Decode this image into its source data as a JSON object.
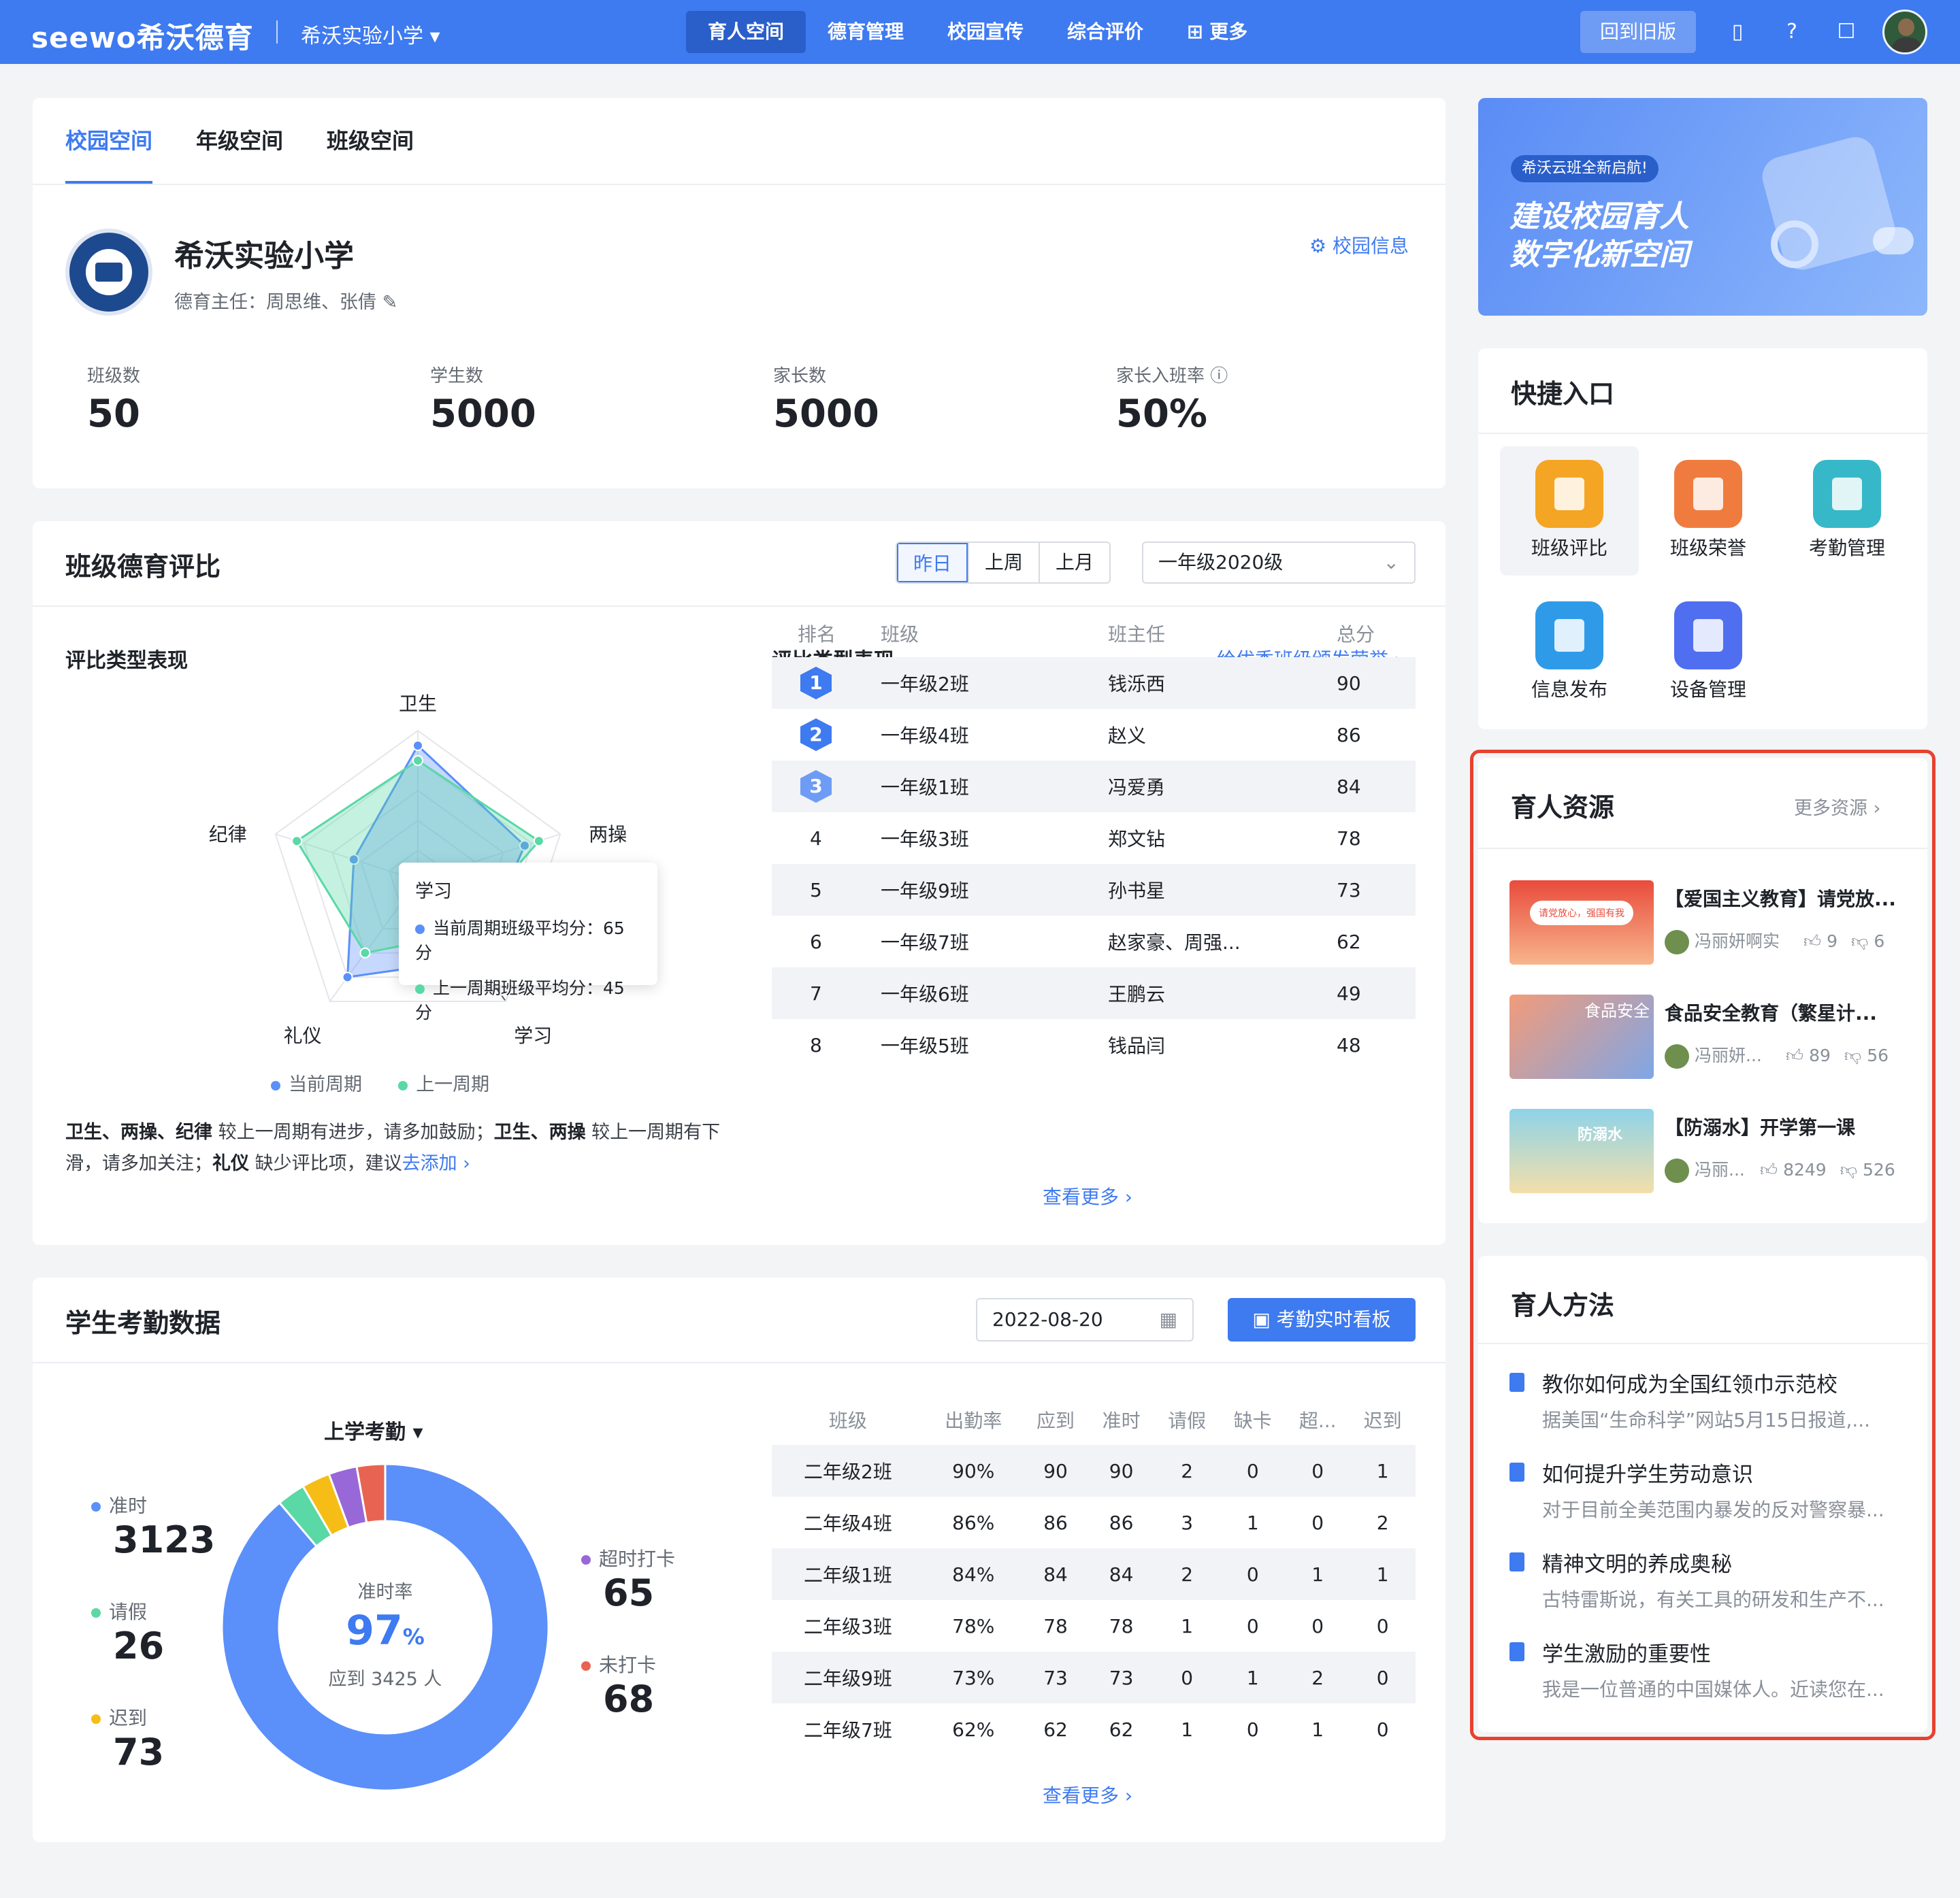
{
  "topbar": {
    "logo": "seewo希沃德育",
    "school": "希沃实验小学 ▾",
    "nav": [
      "育人空间",
      "德育管理",
      "校园宣传",
      "综合评价",
      "⊞ 更多"
    ],
    "old_version": "回到旧版"
  },
  "school_card": {
    "tabs": [
      "校园空间",
      "年级空间",
      "班级空间"
    ],
    "name": "希沃实验小学",
    "director": "德育主任：周思维、张倩 ✎",
    "info_link": "⚙ 校园信息",
    "stats": [
      {
        "label": "班级数",
        "value": "50"
      },
      {
        "label": "学生数",
        "value": "5000"
      },
      {
        "label": "家长数",
        "value": "5000"
      },
      {
        "label": "家长入班率 ⓘ",
        "value": "50%"
      }
    ]
  },
  "eval_card": {
    "title": "班级德育评比",
    "periods": [
      "昨日",
      "上周",
      "上月"
    ],
    "grade_select": "一年级2020级",
    "left_title": "评比类型表现",
    "right_title": "评比类型表现",
    "award_link": "给优秀班级颁发荣誉 ›",
    "legend": [
      "当前周期",
      "上一周期"
    ],
    "tooltip": {
      "title": "学习",
      "current": "当前周期班级平均分：65分",
      "previous": "上一周期班级平均分：45分"
    },
    "summary": [
      {
        "b": "卫生、两操、纪律"
      },
      {
        "t": " 较上一周期有进步，请多加鼓励；"
      },
      {
        "b": "卫生、两操"
      },
      {
        "t": " 较上一周期有下滑，请多加关注；"
      },
      {
        "b": "礼仪"
      },
      {
        "t": " 缺少评比项，建议去添加 "
      },
      {
        "l": "去添加 ›"
      }
    ],
    "rank_headers": [
      "排名",
      "班级",
      "班主任",
      "总分"
    ],
    "rank_rows": [
      [
        "1",
        "一年级2班",
        "钱泺西",
        "90"
      ],
      [
        "2",
        "一年级4班",
        "赵义",
        "86"
      ],
      [
        "3",
        "一年级1班",
        "冯爱勇",
        "84"
      ],
      [
        "4",
        "一年级3班",
        "郑文钻",
        "78"
      ],
      [
        "5",
        "一年级9班",
        "孙书星",
        "73"
      ],
      [
        "6",
        "一年级7班",
        "赵家豪、周强...",
        "62"
      ],
      [
        "7",
        "一年级6班",
        "王鹏云",
        "49"
      ],
      [
        "8",
        "一年级5班",
        "钱品闫",
        "48"
      ]
    ],
    "more": "查看更多 ›"
  },
  "chart_data": [
    {
      "type": "radar",
      "axes": [
        "卫生",
        "两操",
        "学习",
        "礼仪",
        "纪律"
      ],
      "series": [
        {
          "name": "当前周期",
          "values": [
            90,
            75,
            65,
            80,
            45
          ]
        },
        {
          "name": "上一周期",
          "values": [
            80,
            85,
            45,
            60,
            85
          ]
        }
      ],
      "range": [
        0,
        100
      ],
      "color_current": "#5b8ff9",
      "color_previous": "#5ad8a6"
    },
    {
      "type": "pie",
      "center_label": "准时率",
      "center_value": "97",
      "center_unit": "%",
      "center_sub": "应到 3425 人",
      "slices": [
        {
          "name": "准时",
          "value": 3123,
          "color": "#5b8ff9"
        },
        {
          "name": "请假",
          "value": 26,
          "color": "#5ad8a6"
        },
        {
          "name": "迟到",
          "value": 73,
          "color": "#f6bd16"
        },
        {
          "name": "超时打卡",
          "value": 65,
          "color": "#9867d8"
        },
        {
          "name": "未打卡",
          "value": 68,
          "color": "#e86452"
        }
      ]
    }
  ],
  "attendance_card": {
    "title": "学生考勤数据",
    "date": "2022-08-20",
    "board_btn": "考勤实时看板",
    "mode": "上学考勤 ▾",
    "kpis": [
      {
        "label": "准时",
        "value": "3123"
      },
      {
        "label": "请假",
        "value": "26"
      },
      {
        "label": "迟到",
        "value": "73"
      },
      {
        "label": "超时打卡",
        "value": "65"
      },
      {
        "label": "未打卡",
        "value": "68"
      }
    ],
    "headers": [
      "班级",
      "出勤率",
      "应到",
      "准时",
      "请假",
      "缺卡",
      "超...",
      "迟到"
    ],
    "rows": [
      [
        "二年级2班",
        "90%",
        "90",
        "90",
        "2",
        "0",
        "0",
        "1"
      ],
      [
        "二年级4班",
        "86%",
        "86",
        "86",
        "3",
        "1",
        "0",
        "2"
      ],
      [
        "二年级1班",
        "84%",
        "84",
        "84",
        "2",
        "0",
        "1",
        "1"
      ],
      [
        "二年级3班",
        "78%",
        "78",
        "78",
        "1",
        "0",
        "0",
        "0"
      ],
      [
        "二年级9班",
        "73%",
        "73",
        "73",
        "0",
        "1",
        "2",
        "0"
      ],
      [
        "二年级7班",
        "62%",
        "62",
        "62",
        "1",
        "0",
        "1",
        "0"
      ]
    ],
    "more": "查看更多 ›"
  },
  "banner": {
    "tag": "希沃云班全新启航!",
    "line1": "建设校园育人",
    "line2": "数字化新空间"
  },
  "quick": {
    "title": "快捷入口",
    "items": [
      {
        "label": "班级评比",
        "color": "#f5a524"
      },
      {
        "label": "班级荣誉",
        "color": "#f07b3f"
      },
      {
        "label": "考勤管理",
        "color": "#36b8c9"
      },
      {
        "label": "信息发布",
        "color": "#2f9be8"
      },
      {
        "label": "设备管理",
        "color": "#4f6ef0"
      }
    ]
  },
  "resources": {
    "title": "育人资源",
    "more": "更多资源 ›",
    "items": [
      {
        "title": "【爱国主义教育】请党放...",
        "author": "冯丽妍啊实",
        "likes": "9",
        "dislikes": "6",
        "thumb_text": "请党放心，强国有我"
      },
      {
        "title": "食品安全教育（繁星计...",
        "author": "冯丽妍...",
        "likes": "89",
        "dislikes": "56",
        "thumb_text": "食品安全"
      },
      {
        "title": "【防溺水】开学第一课",
        "author": "冯丽...",
        "likes": "8249",
        "dislikes": "526",
        "thumb_text": "防溺水"
      }
    ]
  },
  "methods": {
    "title": "育人方法",
    "items": [
      {
        "t": "教你如何成为全国红领巾示范校",
        "d": "据美国“生命科学”网站5月15日报道,..."
      },
      {
        "t": "如何提升学生劳动意识",
        "d": "对于目前全美范围内暴发的反对警察暴..."
      },
      {
        "t": "精神文明的养成奥秘",
        "d": "古特雷斯说，有关工具的研发和生产不..."
      },
      {
        "t": "学生激励的重要性",
        "d": "我是一位普通的中国媒体人。近读您在..."
      }
    ]
  }
}
